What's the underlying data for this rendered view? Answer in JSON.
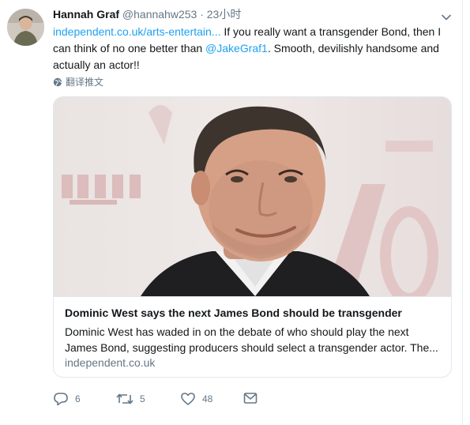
{
  "tweet": {
    "author_name": "Hannah Graf",
    "author_handle": "@hannahw253",
    "separator": "·",
    "timestamp": "23小时",
    "link_text": "independent.co.uk/arts-entertain...",
    "text_part1": " If you really want a transgender Bond, then I can think of no one better than ",
    "mention": "@JakeGraf1",
    "text_part2": ". Smooth, devilishly handsome and actually an actor!!",
    "translate_label": "翻译推文"
  },
  "card": {
    "title": "Dominic West says the next James Bond should be transgender",
    "description": "Dominic West has waded in on the debate of who should play the next James Bond, suggesting producers should select a transgender actor. The...",
    "domain": "independent.co.uk"
  },
  "actions": {
    "reply_count": "6",
    "retweet_count": "5",
    "like_count": "48"
  },
  "icons": {
    "reply": "reply-icon",
    "retweet": "retweet-icon",
    "like": "heart-icon",
    "dm": "envelope-icon",
    "caret": "chevron-down-icon",
    "globe": "globe-icon"
  },
  "colors": {
    "link": "#1da1f2",
    "muted": "#657786",
    "text": "#14171a",
    "border": "#e1e8ed"
  }
}
